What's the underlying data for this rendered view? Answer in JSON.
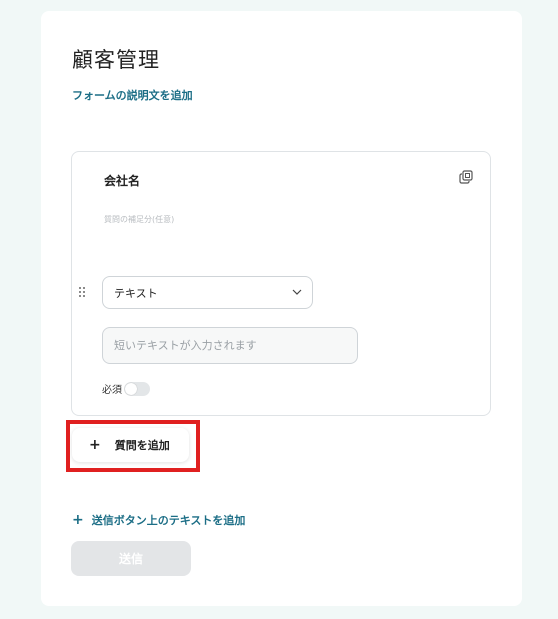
{
  "form": {
    "title": "顧客管理",
    "add_description_label": "フォームの説明文を追加"
  },
  "question": {
    "name": "会社名",
    "help_text": "質問の補足分(任意)",
    "type_selected": "テキスト",
    "answer_placeholder": "短いテキストが入力されます",
    "required_label": "必須",
    "required_on": false
  },
  "actions": {
    "add_question_plus": "+",
    "add_question_label": "質問を追加",
    "add_submit_text_plus": "+",
    "add_submit_text_label": "送信ボタン上のテキストを追加",
    "submit_label": "送信"
  },
  "colors": {
    "link": "#1c6e86",
    "highlight": "#e02020",
    "background": "#f1f8f7"
  }
}
